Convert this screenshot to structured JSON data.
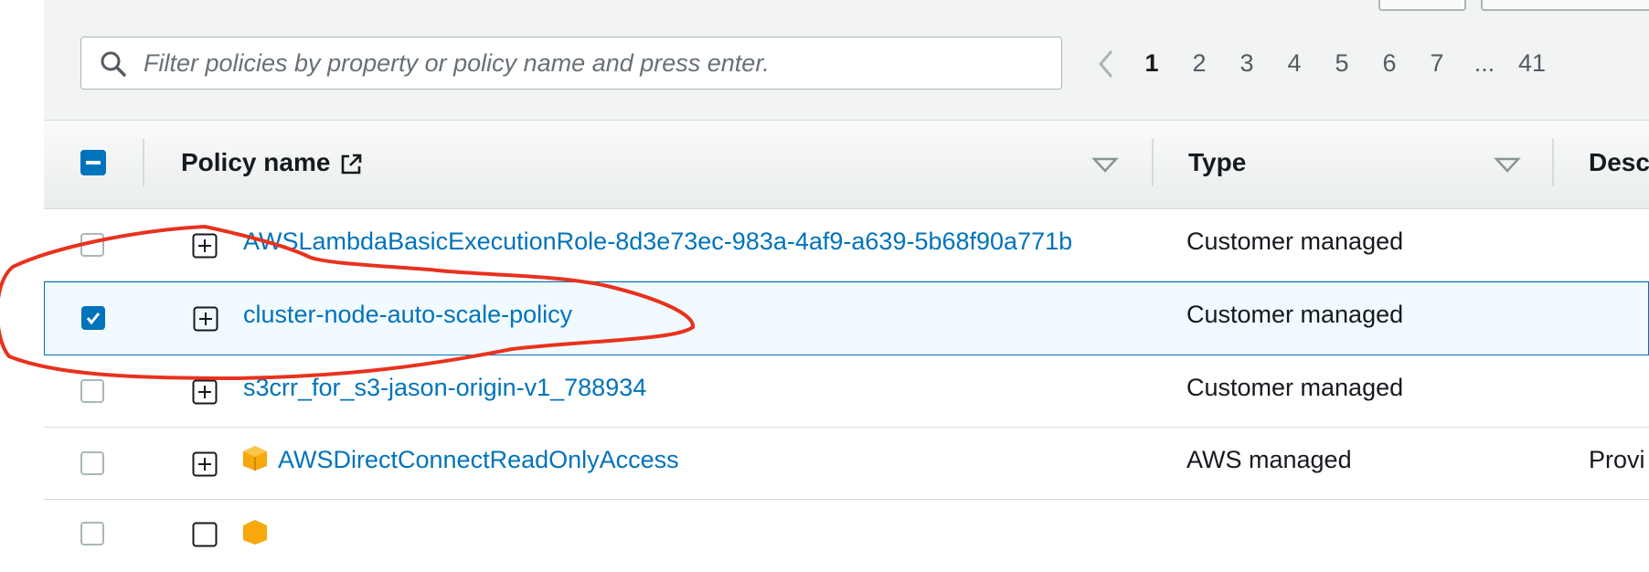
{
  "search": {
    "placeholder": "Filter policies by property or policy name and press enter."
  },
  "pagination": {
    "pages": [
      "1",
      "2",
      "3",
      "4",
      "5",
      "6",
      "7",
      "...",
      "41"
    ],
    "current": "1"
  },
  "table": {
    "columns": {
      "policy_name": "Policy name",
      "type": "Type",
      "description": "Desc"
    },
    "rows": [
      {
        "name": "AWSLambdaBasicExecutionRole-8d3e73ec-983a-4af9-a639-5b68f90a771b",
        "type": "Customer managed",
        "description": "",
        "checked": false,
        "aws_icon": false
      },
      {
        "name": "cluster-node-auto-scale-policy",
        "type": "Customer managed",
        "description": "",
        "checked": true,
        "aws_icon": false
      },
      {
        "name": "s3crr_for_s3-jason-origin-v1_788934",
        "type": "Customer managed",
        "description": "",
        "checked": false,
        "aws_icon": false
      },
      {
        "name": "AWSDirectConnectReadOnlyAccess",
        "type": "AWS managed",
        "description": "Provi",
        "checked": false,
        "aws_icon": true
      }
    ]
  },
  "colors": {
    "link": "#0073bb",
    "annotation": "#e8321e",
    "selected_row_bg": "#f1faff"
  }
}
